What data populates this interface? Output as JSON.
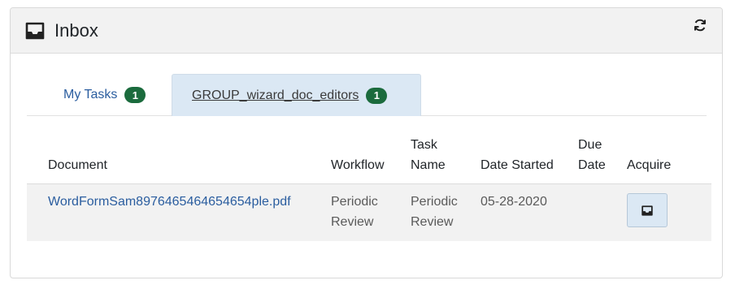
{
  "panel": {
    "title": "Inbox",
    "header_icon": "inbox-icon",
    "refresh_icon": "refresh-icon"
  },
  "tabs": [
    {
      "label": "My Tasks",
      "count": "1",
      "active": false
    },
    {
      "label": "GROUP_wizard_doc_editors",
      "count": "1",
      "active": true
    }
  ],
  "table": {
    "headers": {
      "document": "Document",
      "workflow": "Workflow",
      "task_name": "Task Name",
      "date_started": "Date Started",
      "due_date": "Due Date",
      "acquire": "Acquire"
    },
    "rows": [
      {
        "document": "WordFormSam8976465464654654ple.pdf",
        "workflow": "Periodic Review",
        "task_name": "Periodic Review",
        "date_started": "05-28-2020",
        "due_date": "",
        "acquire_icon": "inbox-icon"
      }
    ]
  },
  "colors": {
    "accent_link": "#2a5d9f",
    "badge": "#1b6b3d",
    "active_tab_bg": "#dbe8f4",
    "header_bg": "#f2f2f2"
  }
}
